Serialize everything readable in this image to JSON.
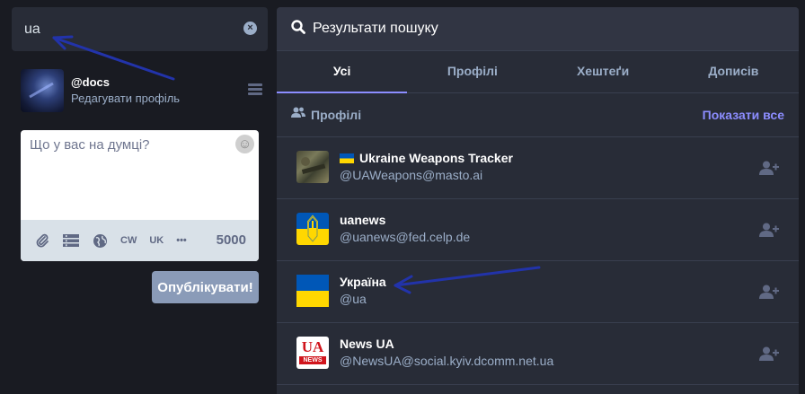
{
  "search": {
    "value": "ua"
  },
  "profile": {
    "handle": "@docs",
    "edit_link": "Редагувати профіль"
  },
  "compose": {
    "placeholder": "Що у вас на думці?",
    "cw_label": "CW",
    "lang_label": "UK",
    "more_label": "•••",
    "char_count": "5000",
    "publish_label": "Опублікувати!"
  },
  "results": {
    "header_title": "Результати пошуку",
    "tabs": [
      {
        "label": "Усі",
        "active": true
      },
      {
        "label": "Профілі",
        "active": false
      },
      {
        "label": "Хештеґи",
        "active": false
      },
      {
        "label": "Дописів",
        "active": false
      }
    ],
    "section_label": "Профілі",
    "show_all": "Показати все",
    "accounts": [
      {
        "name": "Ukraine Weapons Tracker",
        "handle": "@UAWeapons@masto.ai",
        "has_flag": true
      },
      {
        "name": "uanews",
        "handle": "@uanews@fed.celp.de"
      },
      {
        "name": "Україна",
        "handle": "@ua"
      },
      {
        "name": "News UA",
        "handle": "@NewsUA@social.kyiv.dcomm.net.ua",
        "logo_text": "UA",
        "logo_sub": "NEWS"
      }
    ]
  },
  "colors": {
    "background": "#191b22",
    "panel": "#282c37",
    "accent": "#8c8dff",
    "annotation_arrow": "#2233aa",
    "flag_blue": "#0057b7",
    "flag_yellow": "#ffd700"
  }
}
